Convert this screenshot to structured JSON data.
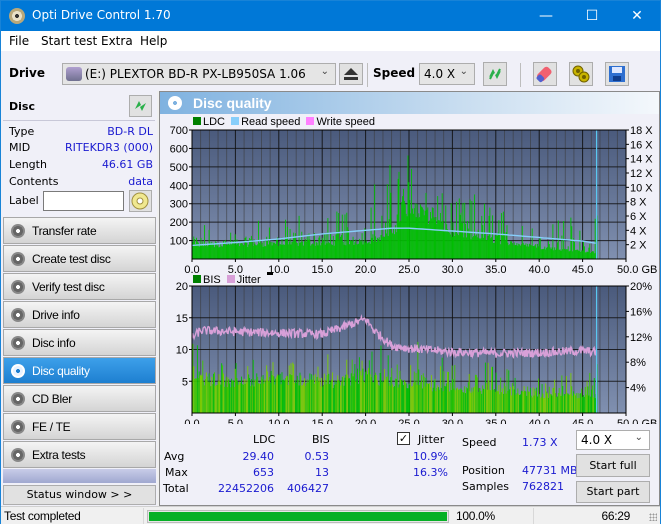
{
  "window": {
    "title": "Opti Drive Control 1.70",
    "minimize": "—",
    "maximize": "☐",
    "close": "✕"
  },
  "menu": [
    "File",
    "Start test",
    "Extra",
    "Help"
  ],
  "toolbar": {
    "drive_label": "Drive",
    "drive_value": "(E:)  PLEXTOR BD-R  PX-LB950SA 1.06",
    "speed_label": "Speed",
    "speed_value": "4.0 X",
    "icons": [
      "eject-icon",
      "refresh-icon",
      "erase-icon",
      "settings-icon",
      "save-icon"
    ]
  },
  "disc": {
    "header": "Disc",
    "type_label": "Type",
    "type_value": "BD-R DL",
    "mid_label": "MID",
    "mid_value": "RITEKDR3 (000)",
    "length_label": "Length",
    "length_value": "46.61 GB",
    "contents_label": "Contents",
    "contents_value": "data",
    "label_label": "Label",
    "label_value": ""
  },
  "nav": [
    {
      "label": "Transfer rate",
      "active": false
    },
    {
      "label": "Create test disc",
      "active": false
    },
    {
      "label": "Verify test disc",
      "active": false
    },
    {
      "label": "Drive info",
      "active": false
    },
    {
      "label": "Disc info",
      "active": false
    },
    {
      "label": "Disc quality",
      "active": true
    },
    {
      "label": "CD Bler",
      "active": false
    },
    {
      "label": "FE / TE",
      "active": false
    },
    {
      "label": "Extra tests",
      "active": false
    }
  ],
  "status_window_button": "Status window > >",
  "panel": {
    "title": "Disc quality"
  },
  "colors": {
    "ldc": "#008000",
    "read_speed": "#87cefa",
    "write_speed": "#ff80ff",
    "bis": "#008000",
    "jitter": "#d8a0d8",
    "bars": "#00c000",
    "plot_bg_top": "#4a5a7c",
    "plot_bg_bottom": "#8090b0",
    "progress": "#06b025",
    "value_text": "#1a1ad0"
  },
  "chart_data": [
    {
      "type": "bar",
      "title": "LDC / Read speed",
      "legend": [
        "LDC",
        "Read speed",
        "Write speed"
      ],
      "legend_position": "top-left",
      "x_ticks": [
        "0.0",
        "5.0",
        "10.0",
        "15.0",
        "20.0",
        "25.0",
        "30.0",
        "35.0",
        "40.0",
        "45.0",
        "50.0 GB"
      ],
      "xlim": [
        0,
        50
      ],
      "y_left_ticks": [
        "100",
        "200",
        "300",
        "400",
        "500",
        "600",
        "700"
      ],
      "ylim_left": [
        0,
        700
      ],
      "y_right_ticks": [
        "2 X",
        "4 X",
        "6 X",
        "8 X",
        "10 X",
        "12 X",
        "14 X",
        "16 X",
        "18 X"
      ],
      "ylim_right": [
        0,
        18
      ],
      "grid": true,
      "end_marker_gb": 46.61,
      "series": [
        {
          "name": "LDC (approx envelope peaks)",
          "x": [
            0.5,
            2.5,
            5,
            7.5,
            10,
            12.5,
            15,
            17.5,
            20,
            22.5,
            24,
            25,
            26.5,
            28,
            30,
            32.5,
            35,
            37.5,
            40,
            42.5,
            45,
            46.5
          ],
          "values": [
            200,
            180,
            150,
            230,
            200,
            260,
            230,
            300,
            400,
            500,
            600,
            650,
            420,
            380,
            320,
            360,
            280,
            250,
            230,
            280,
            200,
            260
          ]
        },
        {
          "name": "LDC (baseline)",
          "x": [
            0,
            10,
            20,
            23,
            25,
            30,
            40,
            46.5
          ],
          "values": [
            80,
            90,
            100,
            150,
            330,
            150,
            70,
            40
          ]
        },
        {
          "name": "Read speed",
          "x": [
            0,
            5,
            10,
            15,
            20,
            23,
            25,
            30,
            35,
            40,
            45,
            46.5
          ],
          "values": [
            1.9,
            2.3,
            2.8,
            3.5,
            4.0,
            4.3,
            4.3,
            3.9,
            3.5,
            3.0,
            2.5,
            2.2
          ]
        }
      ]
    },
    {
      "type": "bar",
      "title": "BIS / Jitter",
      "legend": [
        "BIS",
        "Jitter"
      ],
      "legend_position": "top-left",
      "x_ticks": [
        "0.0",
        "5.0",
        "10.0",
        "15.0",
        "20.0",
        "25.0",
        "30.0",
        "35.0",
        "40.0",
        "45.0",
        "50.0 GB"
      ],
      "xlim": [
        0,
        50
      ],
      "y_left_ticks": [
        "5",
        "10",
        "15",
        "20"
      ],
      "ylim_left": [
        0,
        20
      ],
      "y_right_ticks": [
        "4%",
        "8%",
        "12%",
        "16%",
        "20%"
      ],
      "ylim_right": [
        0,
        20
      ],
      "grid": true,
      "end_marker_gb": 46.61,
      "series": [
        {
          "name": "BIS (approx peaks)",
          "x": [
            0.5,
            2.5,
            5,
            7.5,
            10,
            12.5,
            15,
            17.5,
            20,
            22.5,
            25,
            27.5,
            30,
            32.5,
            35,
            37.5,
            40,
            42.5,
            45,
            46.5
          ],
          "values": [
            11,
            9,
            8,
            9,
            8,
            8,
            9,
            10,
            9,
            12,
            13,
            10,
            8,
            11,
            7,
            7,
            6,
            7,
            6,
            8
          ]
        },
        {
          "name": "BIS (baseline)",
          "x": [
            0,
            5,
            10,
            15,
            20,
            25,
            30,
            35,
            40,
            46.5
          ],
          "values": [
            6,
            5,
            6,
            5,
            6,
            5,
            4,
            4,
            3,
            3
          ]
        },
        {
          "name": "Jitter %",
          "x": [
            0,
            1,
            5,
            10,
            15,
            18,
            20,
            21,
            23,
            25,
            30,
            35,
            40,
            45,
            46.5
          ],
          "values": [
            11.8,
            13.0,
            12.8,
            12.6,
            12.4,
            13.8,
            14.8,
            13.0,
            10.6,
            10.2,
            9.6,
            9.4,
            9.5,
            9.8,
            9.6
          ]
        }
      ]
    }
  ],
  "stats": {
    "col_ldc": "LDC",
    "col_bis": "BIS",
    "jitter_label": "Jitter",
    "jitter_checked": true,
    "avg_label": "Avg",
    "avg_ldc": "29.40",
    "avg_bis": "0.53",
    "avg_jitter": "10.9%",
    "max_label": "Max",
    "max_ldc": "653",
    "max_bis": "13",
    "max_jitter": "16.3%",
    "total_label": "Total",
    "total_ldc": "22452206",
    "total_bis": "406427",
    "speed_label": "Speed",
    "speed_value": "1.73 X",
    "position_label": "Position",
    "position_value": "47731 MB",
    "samples_label": "Samples",
    "samples_value": "762821",
    "speed_select": "4.0 X",
    "start_full": "Start full",
    "start_part": "Start part"
  },
  "statusbar": {
    "status": "Test completed",
    "progress": 100.0,
    "progress_text": "100.0%",
    "time": "66:29"
  }
}
